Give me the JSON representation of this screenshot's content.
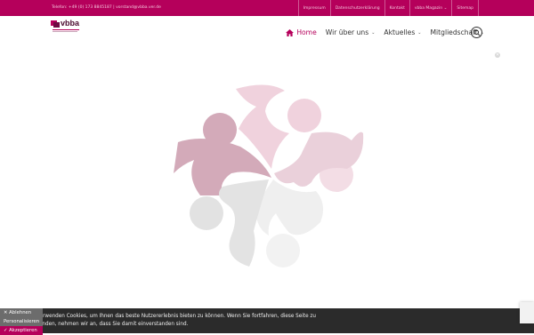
{
  "topbar": {
    "contact": "Telefon: +49 (0) 173 8845187  |  vorstand@vbba.ver.de",
    "links": [
      "Impressum",
      "Datenschutzerklärung",
      "Kontakt",
      "vbba Magazin",
      "Sitemap"
    ]
  },
  "logo": {
    "text": "vbba"
  },
  "nav": {
    "home": "Home",
    "items": [
      "Wir über uns",
      "Aktuelles",
      "Mitgliedschaft"
    ]
  },
  "cookie": {
    "text": "Wir verwenden Cookies, um Ihnen das beste Nutzererlebnis bieten zu können. Wenn Sie fortfahren, diese Seite zu verwenden, nehmen wir an, dass Sie damit einverstanden sind.",
    "decline": "✕ Ablehnen",
    "customize": "Personalisieren",
    "accept": "✓ Akzeptieren"
  },
  "colors": {
    "brand": "#b5005b",
    "cookie_bg": "#2b2b2b"
  }
}
